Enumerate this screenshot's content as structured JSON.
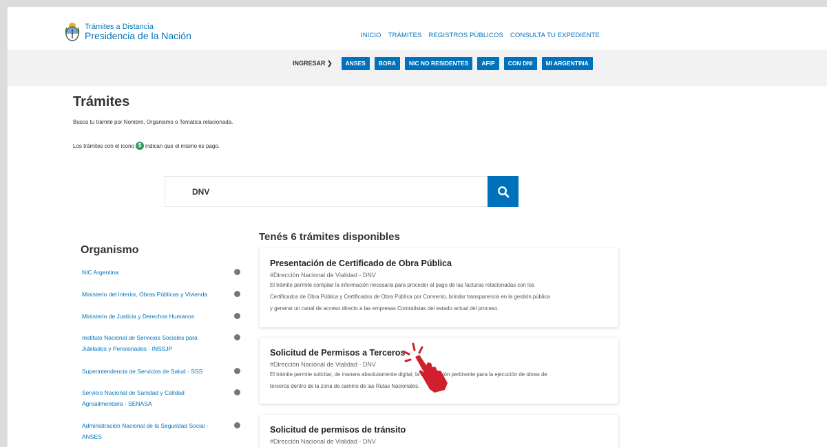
{
  "header": {
    "logo_line1": "Trámites a Distancia",
    "logo_line2": "Presidencia de la Nación",
    "nav": [
      "INICIO",
      "TRÁMITES",
      "REGISTROS PÚBLICOS",
      "CONSULTA TU EXPEDIENTE"
    ]
  },
  "login": {
    "label": "INGRESAR ❯",
    "buttons": [
      "ANSES",
      "BORA",
      "NIC NO RESIDENTES",
      "AFIP",
      "CON DNI",
      "MI ARGENTINA"
    ]
  },
  "page": {
    "title": "Trámites",
    "intro": "Busca tu trámite por Nombre, Organismo o Temática relacionada.",
    "pay_before": "Los trámites con el ícono",
    "pay_icon": "$",
    "pay_after": "indican que el mismo es pago."
  },
  "search": {
    "value": "DNV"
  },
  "sidebar": {
    "title": "Organismo",
    "items": [
      "NIC Argentina",
      "Ministerio del Interior, Obras Públicas y Vivienda",
      "Ministerio de Justicia y Derechos Humanos",
      "Instituto Nacional de Servicios Sociales para Jubilados y Pensionados - INSSJP",
      "Superintendencia de Servicios de Salud - SSS",
      "Servicio Nacional de Sanidad y Calidad Agroalimentaria - SENASA",
      "Administración Nacional de la Seguridad Social - ANSES"
    ]
  },
  "results": {
    "title": "Tenés 6 trámites disponibles",
    "cards": [
      {
        "title": "Presentación de Certificado de Obra Pública",
        "org": "#Dirección Nacional de Vialidad - DNV",
        "desc_lines": [
          "El trámite permite compilar la información necesaria para proceder al pago de las facturas relacionadas con los",
          "Certificados de Obra Pública y Certificados de Obra Pública por Convenio, brindar transparencia en la gestión pública",
          "y generar un canal de acceso directo a las empresas Contratistas del estado actual del proceso."
        ]
      },
      {
        "title": "Solicitud de Permisos a Terceros",
        "org": "#Dirección Nacional de Vialidad - DNV",
        "desc_lines": [
          "El trámite permite solicitar, de manera absolutamente digital, la autorización pertinente para la ejecución de obras de",
          "terceros dentro de la zona de camino de las Rutas Nacionales."
        ]
      },
      {
        "title": "Solicitud de permisos de tránsito",
        "org": "#Dirección Nacional de Vialidad - DNV",
        "desc_lines": []
      }
    ]
  },
  "colors": {
    "primary": "#0072bb",
    "pay_icon": "#2e9e5b",
    "cursor": "#d0202e"
  },
  "icons": {
    "logo": "argentina-coat-of-arms-icon",
    "search": "search-icon",
    "count": "count-badge-icon",
    "cursor": "hand-pointer-click-icon"
  }
}
